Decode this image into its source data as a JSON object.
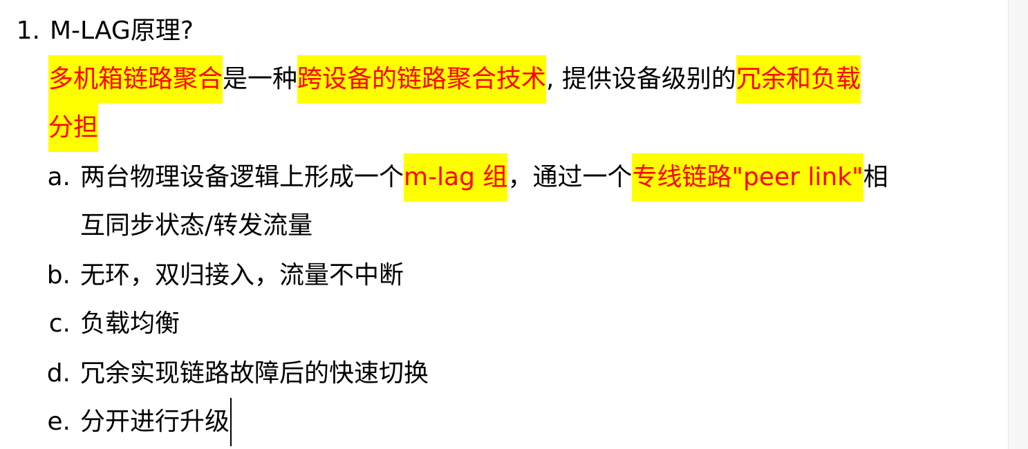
{
  "colors": {
    "highlight_bg": "#ffff00",
    "highlight_text": "#ff0000",
    "text": "#000000",
    "page": "#ffffff"
  },
  "heading": {
    "number": "1.",
    "title": "M-LAG原理?"
  },
  "summary": {
    "hl1": "多机箱链路聚合",
    "t1": "是一种",
    "hl2": "跨设备的链路聚合技术",
    "t2": ", 提供设备级别的",
    "hl3": "冗余和负载",
    "hl4": "分担"
  },
  "items": {
    "a": {
      "marker": "a.",
      "t1": "两台物理设备逻辑上形成一个",
      "hl1": "m-lag 组",
      "t2": "，通过一个",
      "hl2": "专线链路\"peer link\"",
      "t3": "相",
      "cont": "互同步状态/转发流量"
    },
    "b": {
      "marker": "b.",
      "text": "无环，双归接入，流量不中断"
    },
    "c": {
      "marker": "c.",
      "text": "负载均衡"
    },
    "d": {
      "marker": "d.",
      "text": "冗余实现链路故障后的快速切换"
    },
    "e": {
      "marker": "e.",
      "text": "分开进行升级"
    }
  }
}
